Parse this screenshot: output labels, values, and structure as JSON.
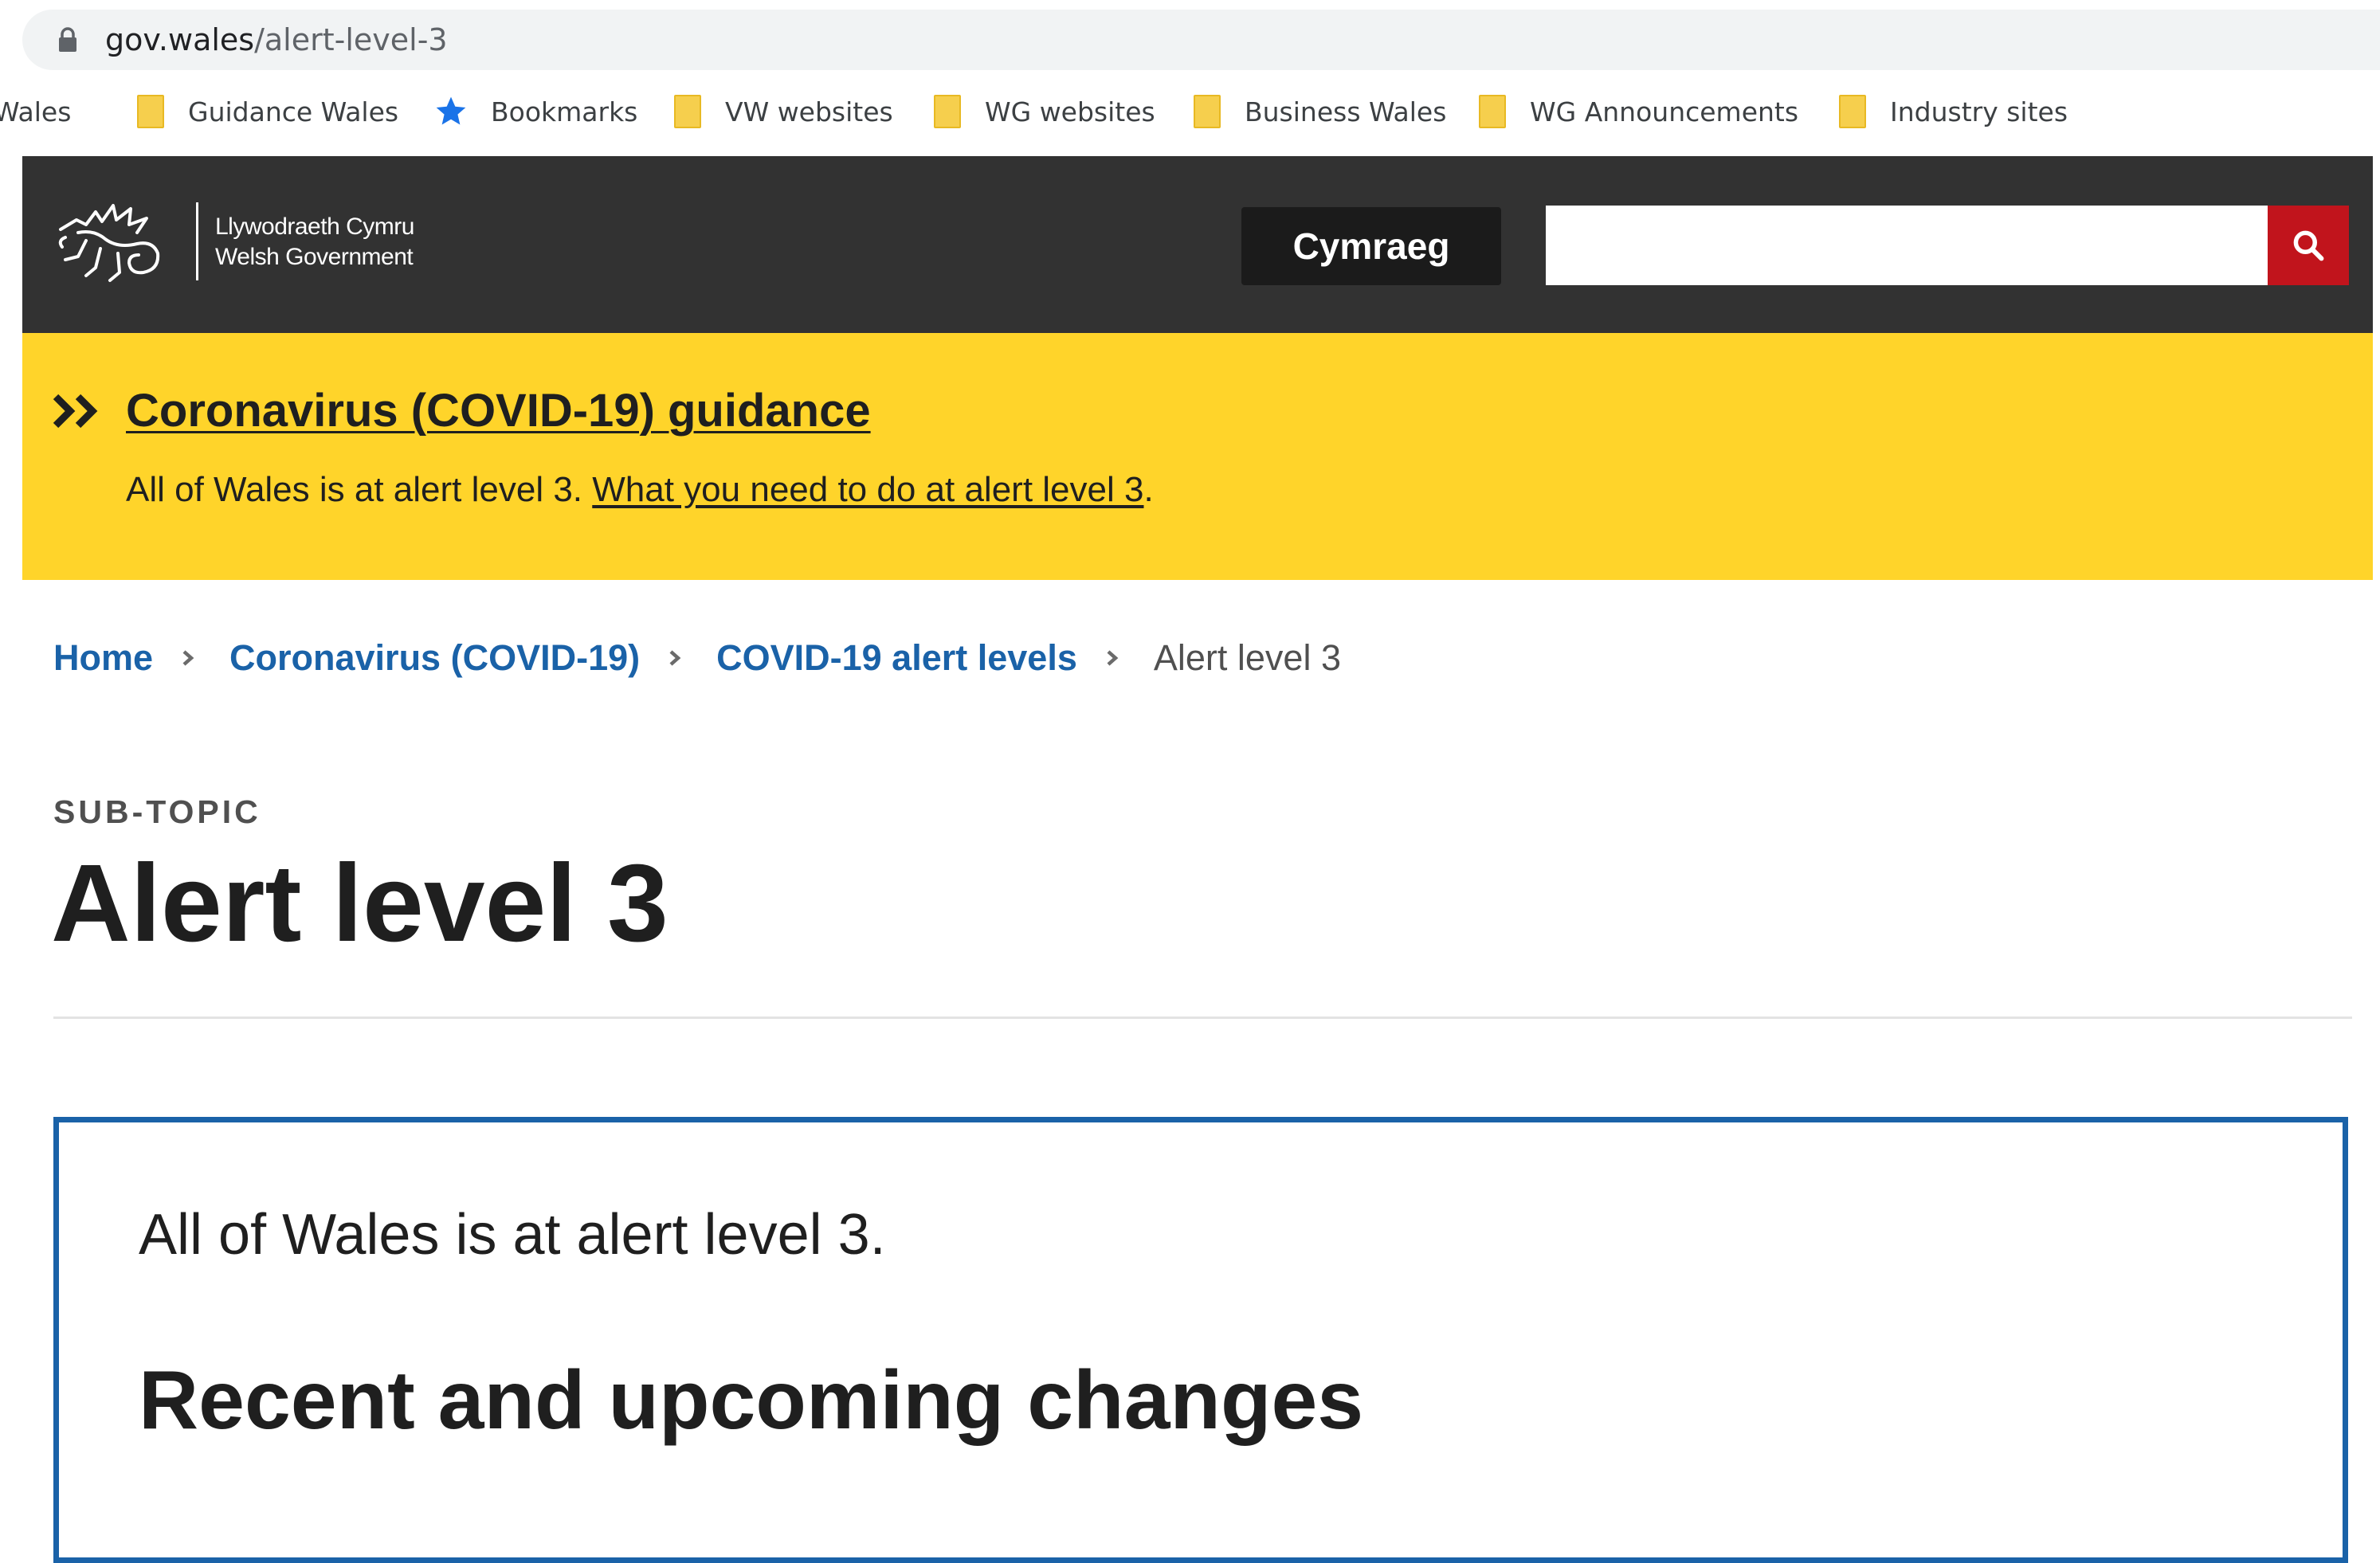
{
  "browser": {
    "url_host": "gov.wales",
    "url_path": "/alert-level-3"
  },
  "bookmarks": [
    {
      "label": "Wales",
      "icon": "none"
    },
    {
      "label": "Guidance Wales",
      "icon": "folder-icon"
    },
    {
      "label": "Bookmarks",
      "icon": "star-icon"
    },
    {
      "label": "VW websites",
      "icon": "folder-icon"
    },
    {
      "label": "WG websites",
      "icon": "folder-icon"
    },
    {
      "label": "Business Wales",
      "icon": "folder-icon"
    },
    {
      "label": "WG Announcements",
      "icon": "folder-icon"
    },
    {
      "label": "Industry sites",
      "icon": "folder-icon"
    }
  ],
  "header": {
    "logo_line1": "Llywodraeth Cymru",
    "logo_line2": "Welsh Government",
    "language_button": "Cymraeg",
    "search_value": "",
    "colors": {
      "header_bg": "#323232",
      "search_button": "#c1141c"
    }
  },
  "banner": {
    "title": "Coronavirus (COVID-19) guidance",
    "text": "All of Wales is at alert level 3. ",
    "link": "What you need to do at alert level 3",
    "trailing": ".",
    "color": "#ffd42a"
  },
  "breadcrumb": {
    "items": [
      {
        "label": "Home"
      },
      {
        "label": "Coronavirus (COVID-19)"
      },
      {
        "label": "COVID-19 alert levels"
      }
    ],
    "current": "Alert level 3",
    "link_color": "#1a62a8"
  },
  "page": {
    "subtopic": "SUB-TOPIC",
    "title": "Alert level 3"
  },
  "callout": {
    "text": "All of Wales is at alert level 3.",
    "heading": "Recent and upcoming changes",
    "border_color": "#1a62a8"
  }
}
